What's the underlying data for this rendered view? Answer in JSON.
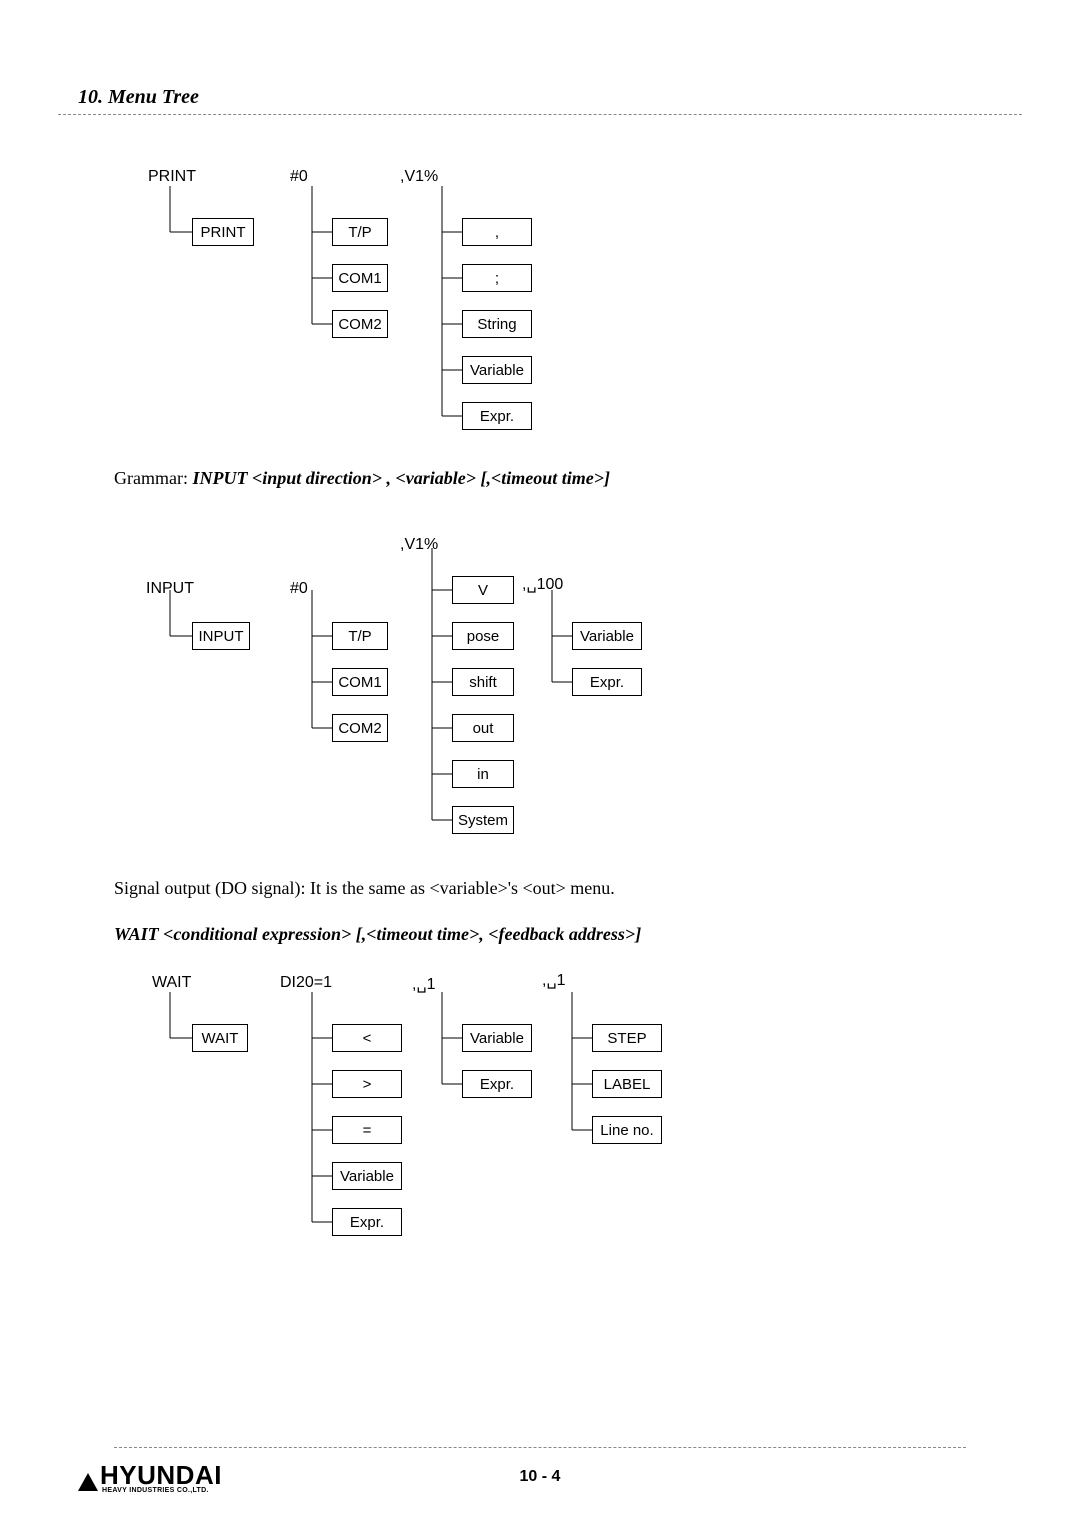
{
  "header": {
    "chapter": "10. Menu Tree"
  },
  "diagram_print": {
    "root_label": "PRINT",
    "root_box": "PRINT",
    "col2_header": "#0",
    "col2": [
      "T/P",
      "COM1",
      "COM2"
    ],
    "col3_header": ",V1%",
    "col3": [
      ",",
      ";",
      "String",
      "Variable",
      "Expr."
    ]
  },
  "grammar1": {
    "prefix": "Grammar: ",
    "body": "INPUT <input direction> , <variable> [,<timeout time>]"
  },
  "diagram_input": {
    "root_label": "INPUT",
    "root_box": "INPUT",
    "col2_header": "#0",
    "col2": [
      "T/P",
      "COM1",
      "COM2"
    ],
    "col3_header": ",V1%",
    "col3": [
      "V",
      "pose",
      "shift",
      "out",
      "in",
      "System"
    ],
    "col4_header": ",␣100",
    "col4": [
      "Variable",
      "Expr."
    ]
  },
  "body_text": {
    "signal": "Signal output (DO signal): It is the same as <variable>'s <out> menu."
  },
  "grammar2": {
    "body": "WAIT <conditional expression> [,<timeout time>, <feedback address>]"
  },
  "diagram_wait": {
    "root_label": "WAIT",
    "root_box": "WAIT",
    "col2_header": "DI20=1",
    "col2": [
      "<",
      ">",
      "=",
      "Variable",
      "Expr."
    ],
    "col3_header": ",␣1",
    "col3": [
      "Variable",
      "Expr."
    ],
    "col4_header": ",␣1",
    "col4": [
      "STEP",
      "LABEL",
      "Line no."
    ]
  },
  "footer": {
    "logo_main": "HYUNDAI",
    "logo_sub": "HEAVY INDUSTRIES CO.,LTD.",
    "page": "10 - 4"
  }
}
